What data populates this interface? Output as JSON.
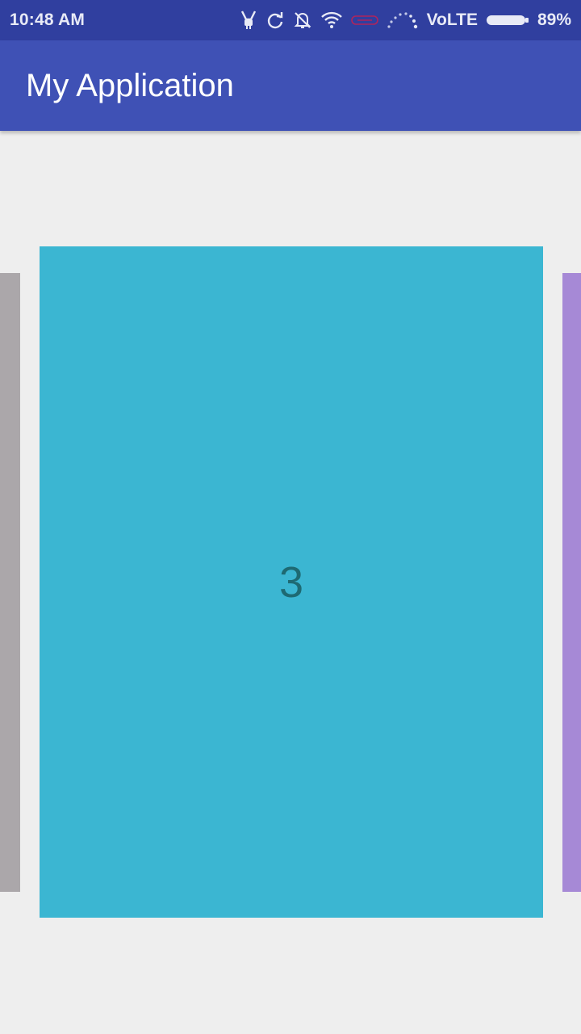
{
  "status_bar": {
    "time": "10:48 AM",
    "network_label": "VoLTE",
    "battery_percent": "89%",
    "icons": [
      "usb-debug-icon",
      "sync-icon",
      "alarm-off-icon",
      "wifi-icon",
      "data-saver-icon",
      "signal-icon",
      "battery-icon"
    ]
  },
  "app_bar": {
    "title": "My Application"
  },
  "pager": {
    "current_page_label": "3",
    "colors": {
      "prev": "#aba7aa",
      "current": "#3bb6d2",
      "next": "#a689d6",
      "number": "#1e6a73"
    }
  },
  "colors": {
    "status_bar": "#303f9f",
    "app_bar": "#3f51b5",
    "background": "#eeeeee"
  }
}
